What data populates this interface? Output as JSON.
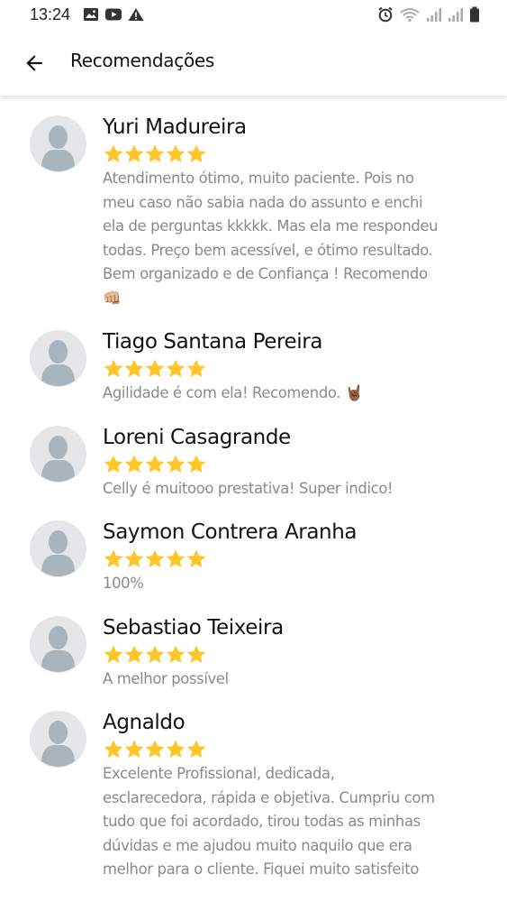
{
  "status_bar": {
    "time": "13:24",
    "left_icons": [
      "image-icon",
      "youtube-icon",
      "warning-icon"
    ],
    "right_icons": [
      "alarm-icon",
      "wifi-icon",
      "signal-icon",
      "signal-icon",
      "battery-icon"
    ]
  },
  "header": {
    "title": "Recomendações",
    "back_icon": "arrow-back-icon"
  },
  "colors": {
    "star": "#FFC629",
    "avatar_bg": "#e4e6e8",
    "avatar_fg": "#a9b4bd",
    "comment": "#8a8a8a"
  },
  "reviews": [
    {
      "name": "Yuri Madureira",
      "rating": 5,
      "comment": "Atendimento ótimo, muito paciente. Pois no\nmeu caso não sabia nada do assunto e enchi\nela de perguntas kkkkk. Mas ela me respondeu\ntodas. Preço bem acessível, e ótimo resultado.\nBem organizado e de Confiança ! Recomendo\n👊🏼"
    },
    {
      "name": "Tiago Santana Pereira",
      "rating": 5,
      "comment": "Agilidade é com ela! Recomendo. 🤘🏾"
    },
    {
      "name": "Loreni Casagrande",
      "rating": 5,
      "comment": "Celly é muitooo prestativa! Super indico!"
    },
    {
      "name": "Saymon Contrera Aranha",
      "rating": 5,
      "comment": "100%"
    },
    {
      "name": "Sebastiao Teixeira",
      "rating": 5,
      "comment": "A melhor possível"
    },
    {
      "name": "Agnaldo",
      "rating": 5,
      "comment": "Excelente Profissional, dedicada,\nesclarecedora, rápida e objetiva. Cumpriu com\ntudo que foi acordado, tirou todas as minhas\ndúvidas e me ajudou muito naquilo que era\nmelhor para o cliente. Fiquei muito satisfeito"
    }
  ]
}
